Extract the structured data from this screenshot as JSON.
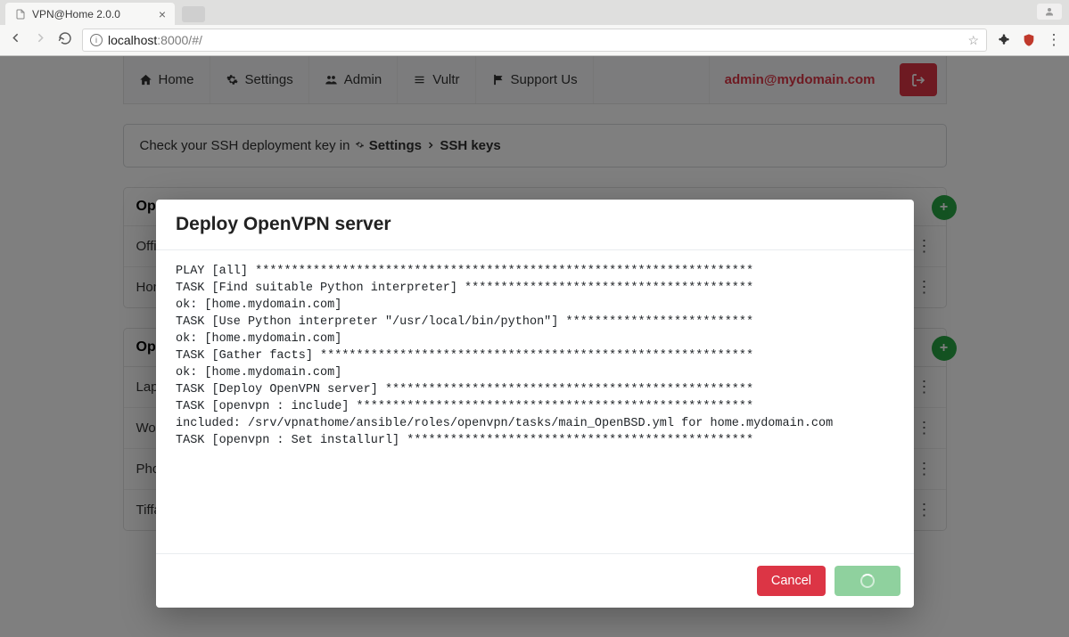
{
  "browser": {
    "tab_title": "VPN@Home 2.0.0",
    "url_host": "localhost",
    "url_rest": ":8000/#/"
  },
  "nav": {
    "home": "Home",
    "settings": "Settings",
    "admin": "Admin",
    "vultr": "Vultr",
    "support": "Support Us",
    "user": "admin@mydomain.com"
  },
  "alert": {
    "prefix": "Check your SSH deployment key in ",
    "link1": "Settings",
    "link2": "SSH keys"
  },
  "sections": {
    "servers_title": "OpenVPN Servers",
    "clients_title": "OpenVPN Clients",
    "server_rows": [
      "Office",
      "Home"
    ],
    "client_rows": [
      "Laptop",
      "Workstation",
      "Phone",
      "Tiffany"
    ]
  },
  "modal": {
    "title": "Deploy OpenVPN server",
    "log": "PLAY [all] *********************************************************************\nTASK [Find suitable Python interpreter] ****************************************\nok: [home.mydomain.com]\nTASK [Use Python interpreter \"/usr/local/bin/python\"] **************************\nok: [home.mydomain.com]\nTASK [Gather facts] ************************************************************\nok: [home.mydomain.com]\nTASK [Deploy OpenVPN server] ***************************************************\nTASK [openvpn : include] *******************************************************\nincluded: /srv/vpnathome/ansible/roles/openvpn/tasks/main_OpenBSD.yml for home.mydomain.com\nTASK [openvpn : Set installurl] ************************************************",
    "cancel": "Cancel"
  }
}
